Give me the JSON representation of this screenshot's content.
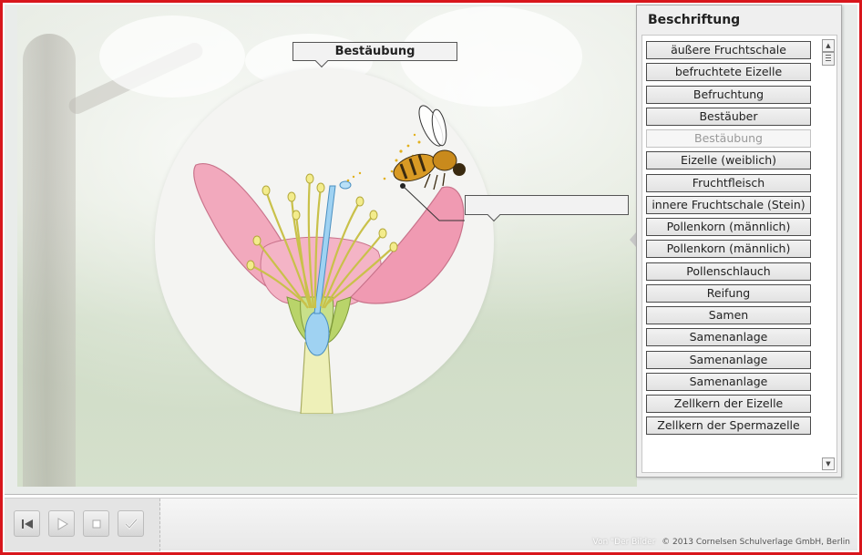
{
  "scene": {
    "title_callout": "Bestäubung",
    "empty_callout": ""
  },
  "panel": {
    "title": "Beschriftung",
    "labels": [
      {
        "text": "äußere Fruchtschale",
        "used": false
      },
      {
        "text": "befruchtete Eizelle",
        "used": false
      },
      {
        "text": "Befruchtung",
        "used": false
      },
      {
        "text": "Bestäuber",
        "used": false
      },
      {
        "text": "Bestäubung",
        "used": true
      },
      {
        "text": "Eizelle (weiblich)",
        "used": false
      },
      {
        "text": "Fruchtfleisch",
        "used": false
      },
      {
        "text": "innere Fruchtschale (Stein)",
        "used": false
      },
      {
        "text": "Pollenkorn (männlich)",
        "used": false
      },
      {
        "text": "Pollenkorn (männlich)",
        "used": false
      },
      {
        "text": "Pollenschlauch",
        "used": false
      },
      {
        "text": "Reifung",
        "used": false
      },
      {
        "text": "Samen",
        "used": false
      },
      {
        "text": "Samenanlage",
        "used": false
      },
      {
        "text": "Samenanlage",
        "used": false
      },
      {
        "text": "Samenanlage",
        "used": false
      },
      {
        "text": "Zellkern der Eizelle",
        "used": false
      },
      {
        "text": "Zellkern der Spermazelle",
        "used": false
      }
    ],
    "scroll_up_icon": "scroll-up-arrow",
    "scroll_down_icon": "scroll-down-arrow"
  },
  "controls": [
    {
      "name": "restart-button",
      "icon": "skip-to-start-icon"
    },
    {
      "name": "play-button",
      "icon": "play-icon"
    },
    {
      "name": "stop-button",
      "icon": "stop-icon"
    },
    {
      "name": "check-button",
      "icon": "checkmark-icon"
    }
  ],
  "footer": {
    "overlay_text": "Von \"Der Bilder",
    "copyright": "© 2013 Cornelsen Schulverlage GmbH, Berlin"
  },
  "colors": {
    "frame": "#d8161c",
    "petal": "#f2a9bd",
    "stamen": "#e8e07a",
    "pistil": "#8ec7ec",
    "bee": "#c98a1c"
  }
}
